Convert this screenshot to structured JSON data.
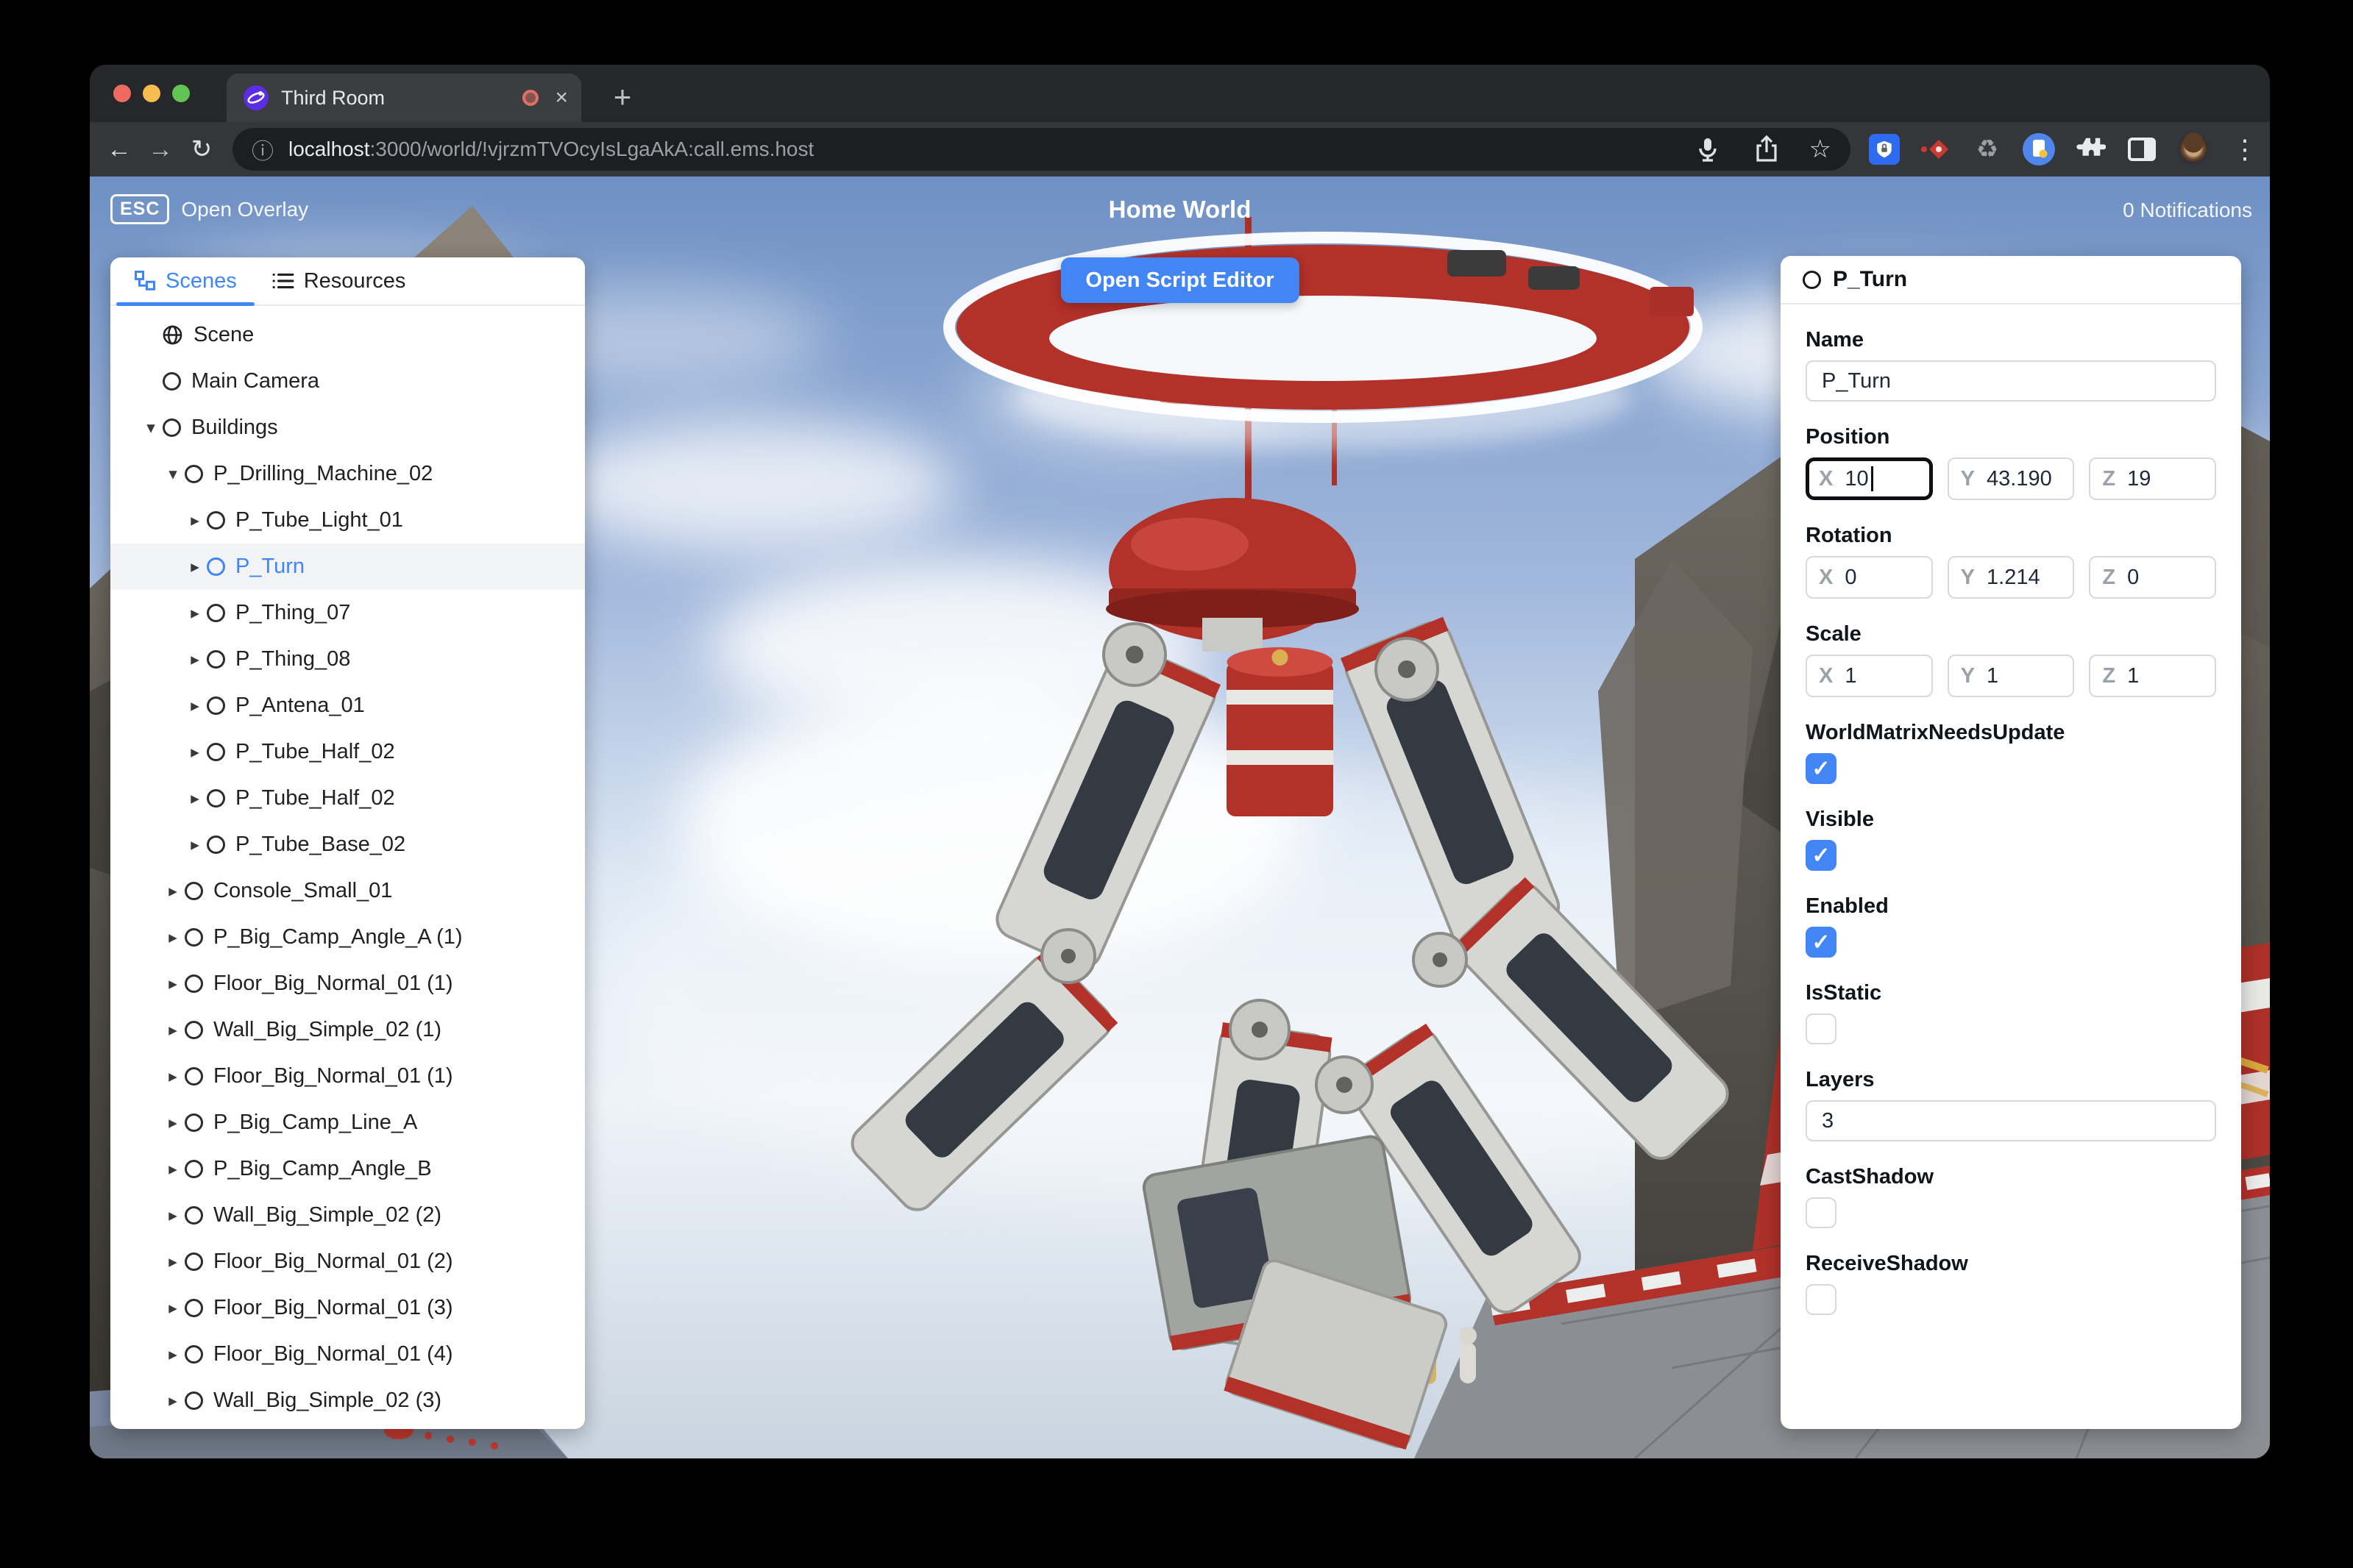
{
  "colors": {
    "accent": "#3f86f6",
    "button_blue": "#4285f4",
    "checkbox_blue": "#4285f4",
    "selected_row_bg": "#f1f3f4",
    "ring_red": "#b23129",
    "traffic_red": "#ee6a5f",
    "traffic_yellow": "#f5bd4f",
    "traffic_green": "#61c454"
  },
  "icons": {
    "arrow_down": "▾",
    "arrow_right": "▸",
    "close": "×",
    "plus": "+",
    "back": "←",
    "forward": "→",
    "reload": "↻",
    "info": "ⓘ",
    "star": "☆",
    "menu_dots": "⋮",
    "recycle": "♻",
    "check": "✓"
  },
  "browser": {
    "tab_title": "Third Room",
    "url_host": "localhost",
    "url_rest": ":3000/world/!vjrzmTVOcyIsLgaAkA:call.ems.host"
  },
  "hud": {
    "esc_key": "ESC",
    "open_overlay": "Open Overlay",
    "world_title": "Home World",
    "notifications": "0 Notifications",
    "open_script_editor": "Open Script Editor"
  },
  "left_panel": {
    "tabs": [
      {
        "label": "Scenes"
      },
      {
        "label": "Resources"
      }
    ],
    "tree": [
      {
        "label": "Scene"
      },
      {
        "label": "Main Camera"
      },
      {
        "label": "Buildings"
      },
      {
        "label": "P_Drilling_Machine_02"
      },
      {
        "label": "P_Tube_Light_01"
      },
      {
        "label": "P_Turn",
        "selected": true
      },
      {
        "label": "P_Thing_07"
      },
      {
        "label": "P_Thing_08"
      },
      {
        "label": "P_Antena_01"
      },
      {
        "label": "P_Tube_Half_02"
      },
      {
        "label": "P_Tube_Half_02"
      },
      {
        "label": "P_Tube_Base_02"
      },
      {
        "label": "Console_Small_01"
      },
      {
        "label": "P_Big_Camp_Angle_A (1)"
      },
      {
        "label": "Floor_Big_Normal_01 (1)"
      },
      {
        "label": "Wall_Big_Simple_02 (1)"
      },
      {
        "label": "Floor_Big_Normal_01 (1)"
      },
      {
        "label": "P_Big_Camp_Line_A"
      },
      {
        "label": "P_Big_Camp_Angle_B"
      },
      {
        "label": "Wall_Big_Simple_02 (2)"
      },
      {
        "label": "Floor_Big_Normal_01 (2)"
      },
      {
        "label": "Floor_Big_Normal_01 (3)"
      },
      {
        "label": "Floor_Big_Normal_01 (4)"
      },
      {
        "label": "Wall_Big_Simple_02 (3)"
      }
    ]
  },
  "right_panel": {
    "title": "P_Turn",
    "name": {
      "label": "Name",
      "value": "P_Turn"
    },
    "position": {
      "label": "Position",
      "x_axis": "X",
      "x": "10",
      "y_axis": "Y",
      "y": "43.190",
      "z_axis": "Z",
      "z": "19"
    },
    "rotation": {
      "label": "Rotation",
      "x_axis": "X",
      "x": "0",
      "y_axis": "Y",
      "y": "1.214",
      "z_axis": "Z",
      "z": "0"
    },
    "scale": {
      "label": "Scale",
      "x_axis": "X",
      "x": "1",
      "y_axis": "Y",
      "y": "1",
      "z_axis": "Z",
      "z": "1"
    },
    "world_matrix_needs_update": {
      "label": "WorldMatrixNeedsUpdate",
      "checked": true
    },
    "visible": {
      "label": "Visible",
      "checked": true
    },
    "enabled": {
      "label": "Enabled",
      "checked": true
    },
    "is_static": {
      "label": "IsStatic",
      "checked": false
    },
    "layers": {
      "label": "Layers",
      "value": "3"
    },
    "cast_shadow": {
      "label": "CastShadow",
      "checked": false
    },
    "receive_shadow": {
      "label": "ReceiveShadow",
      "checked": false
    }
  }
}
